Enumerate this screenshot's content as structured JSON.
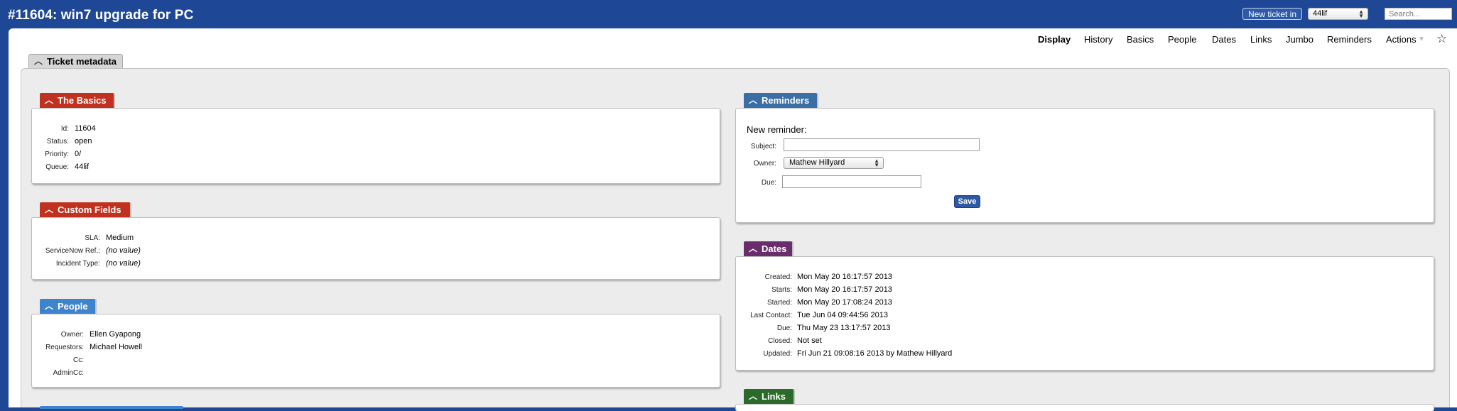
{
  "header": {
    "title": "#11604: win7 upgrade for PC",
    "new_ticket_label": "New ticket in",
    "queue_value": "44lif",
    "search_placeholder": "Search..."
  },
  "menu": [
    "Display",
    "History",
    "Basics",
    "People",
    "Dates",
    "Links",
    "Jumbo",
    "Reminders",
    "Actions"
  ],
  "metadata_tab": "Ticket metadata",
  "basics": {
    "title": "The Basics",
    "color": "#c0321f",
    "rows": [
      {
        "label": "Id:",
        "value": "11604"
      },
      {
        "label": "Status:",
        "value": "open"
      },
      {
        "label": "Priority:",
        "value": "0/"
      },
      {
        "label": "Queue:",
        "value": "44lif"
      }
    ]
  },
  "custom_fields": {
    "title": "Custom Fields",
    "color": "#c0321f",
    "rows": [
      {
        "label": "SLA:",
        "value": "Medium"
      },
      {
        "label": "ServiceNow Ref.:",
        "value": "(no value)"
      },
      {
        "label": "Incident Type:",
        "value": "(no value)"
      }
    ]
  },
  "people": {
    "title": "People",
    "color": "#3d84cc",
    "rows": [
      {
        "label": "Owner:",
        "value": "Ellen Gyapong"
      },
      {
        "label": "Requestors:",
        "value": "Michael Howell"
      },
      {
        "label": "Cc:",
        "value": ""
      },
      {
        "label": "AdminCc:",
        "value": ""
      }
    ]
  },
  "reminders": {
    "title": "Reminders",
    "color": "#3a6ea5",
    "heading": "New reminder:",
    "subject_label": "Subject:",
    "owner_label": "Owner:",
    "owner_value": "Mathew Hillyard",
    "due_label": "Due:",
    "save_label": "Save"
  },
  "dates": {
    "title": "Dates",
    "color": "#6a2d6b",
    "rows": [
      {
        "label": "Created:",
        "value": "Mon May 20 16:17:57 2013"
      },
      {
        "label": "Starts:",
        "value": "Mon May 20 16:17:57 2013"
      },
      {
        "label": "Started:",
        "value": "Mon May 20 17:08:24 2013"
      },
      {
        "label": "Last Contact:",
        "value": "Tue Jun 04 09:44:56 2013"
      },
      {
        "label": "Due:",
        "value": "Thu May 23 13:17:57 2013"
      },
      {
        "label": "Closed:",
        "value": "Not set"
      },
      {
        "label": "Updated:",
        "value": "Fri Jun 21 09:08:16 2013 by Mathew Hillyard"
      }
    ]
  },
  "links": {
    "title": "Links",
    "color": "#2b6a2b"
  },
  "icons": {
    "collapse": "chevron-up-icon",
    "bookmark": "star-icon"
  }
}
